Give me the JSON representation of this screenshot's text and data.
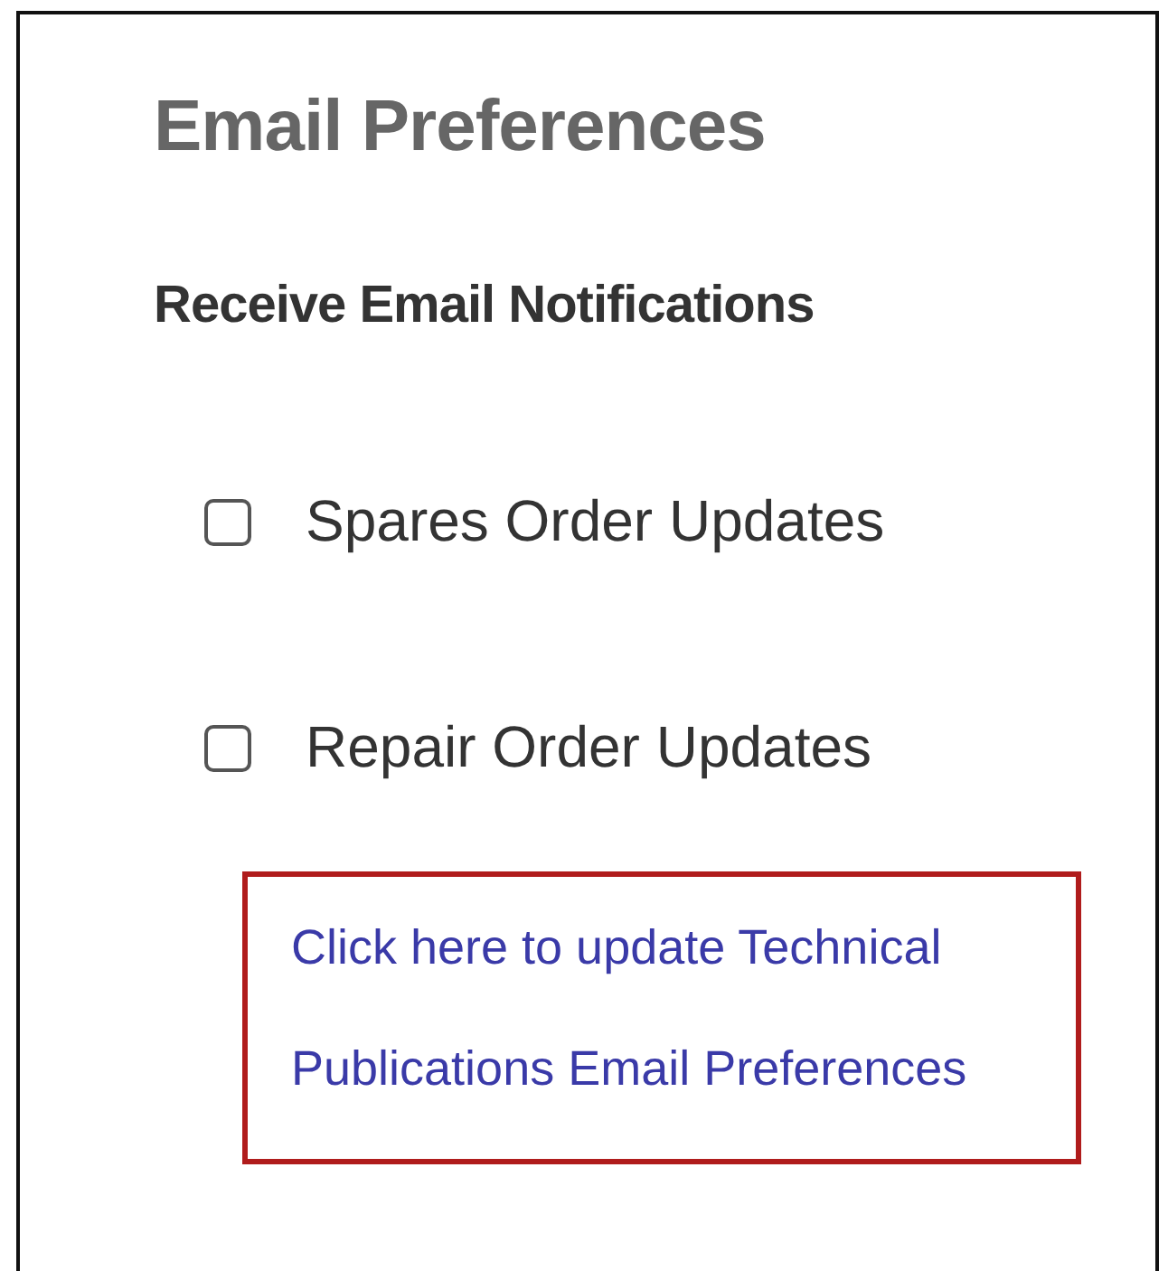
{
  "title": "Email Preferences",
  "section_heading": "Receive Email Notifications",
  "options": [
    {
      "label": "Spares Order Updates",
      "checked": false
    },
    {
      "label": "Repair Order Updates",
      "checked": false
    }
  ],
  "link": {
    "lines": [
      "Click here to update Technical",
      "Publications Email Preferences"
    ]
  }
}
